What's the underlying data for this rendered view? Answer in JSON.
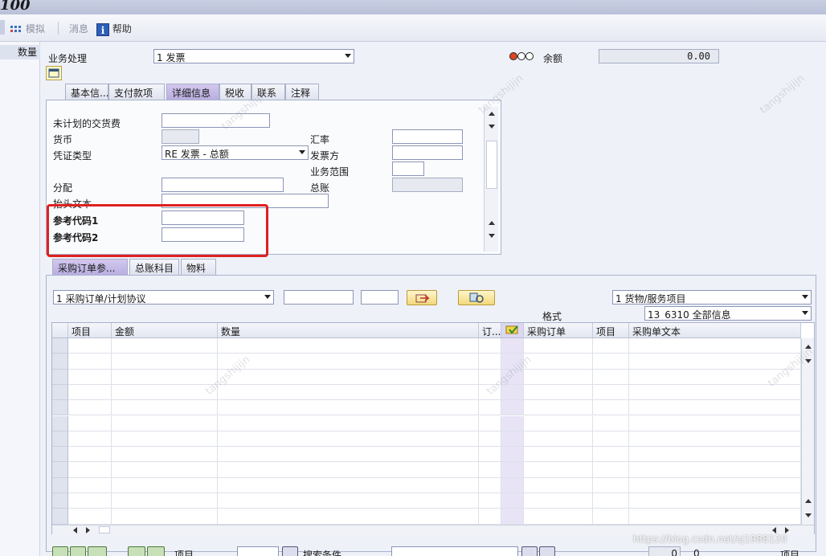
{
  "title": "100",
  "toolbar": {
    "simulate": "模拟",
    "messages": "消息",
    "help": "帮助"
  },
  "left_header": "数量",
  "header": {
    "transaction_label": "业务处理",
    "transaction_value": "1 发票",
    "balance_label": "余额",
    "balance_value": "0.00"
  },
  "tabs_top": [
    "基本信...",
    "支付款项",
    "详细信息",
    "税收",
    "联系",
    "注释"
  ],
  "detail": {
    "unplanned_delivery_label": "未计划的交货费",
    "currency_label": "货币",
    "doc_type_label": "凭证类型",
    "doc_type_value": "RE 发票 - 总额",
    "assignment_label": "分配",
    "header_text_label": "抬头文本",
    "ref_key1_label": "参考代码1",
    "ref_key2_label": "参考代码2",
    "exchange_rate_label": "汇率",
    "invoicing_party_label": "发票方",
    "business_area_label": "业务范围",
    "gl_label": "总账"
  },
  "tabs_bottom": [
    "采购订单参...",
    "总账科目",
    "物料"
  ],
  "po": {
    "ref_type": "1 采购订单/计划协议",
    "goods_service": "1 货物/服务项目",
    "format_label": "格式",
    "format_value": "13_6310 全部信息"
  },
  "table": {
    "columns": [
      "项目",
      "金额",
      "数量",
      "订...",
      "",
      "采购订单",
      "项目",
      "采购单文本"
    ]
  },
  "footer": {
    "item_label": "项目",
    "search_label": "搜索条件",
    "count1": "0",
    "count2": "0",
    "item_label2": "项目",
    "url_watermark": "https://blog.csdn.net/sj1988120"
  },
  "watermark": "tangshijijn"
}
